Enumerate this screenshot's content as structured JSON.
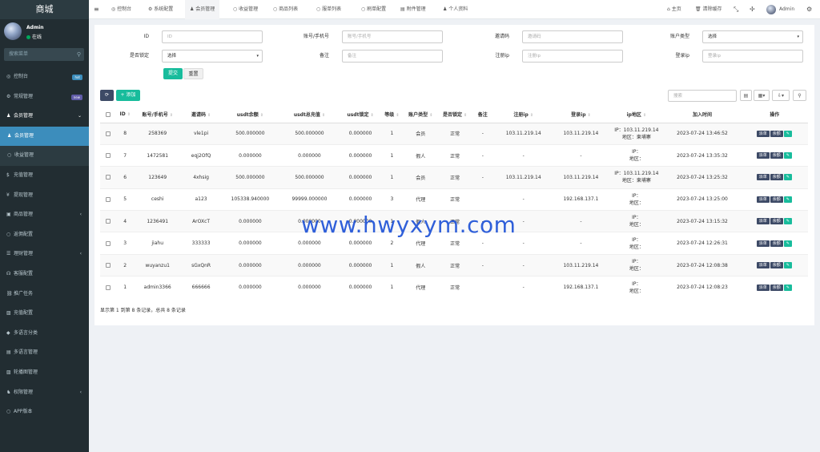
{
  "sidebar": {
    "logo": "商城",
    "user": {
      "name": "Admin",
      "status": "在线"
    },
    "search_placeholder": "搜索菜单",
    "items": [
      {
        "label": "控制台",
        "icon": "dashboard-icon",
        "badge": "hot",
        "badge_color": "#3c8dbc"
      },
      {
        "label": "常规管理",
        "icon": "cogs-icon",
        "badge": "new",
        "badge_color": "#605ca8"
      },
      {
        "label": "会员管理",
        "icon": "user-icon",
        "open": true
      },
      {
        "label": "会员管理",
        "icon": "user-icon",
        "sub": true,
        "active": true
      },
      {
        "label": "收益管理",
        "icon": "circle-icon",
        "sub": true
      },
      {
        "label": "充值管理",
        "icon": "dollar-icon"
      },
      {
        "label": "提现管理",
        "icon": "yen-icon"
      },
      {
        "label": "商品管理",
        "icon": "cart-icon",
        "chevron": true
      },
      {
        "label": "返佣配置",
        "icon": "circle-icon"
      },
      {
        "label": "理财管理",
        "icon": "list-icon",
        "chevron": true
      },
      {
        "label": "客服配置",
        "icon": "headset-icon"
      },
      {
        "label": "推广任务",
        "icon": "link-icon"
      },
      {
        "label": "充值配置",
        "icon": "image-icon"
      },
      {
        "label": "多语言分类",
        "icon": "tag-icon"
      },
      {
        "label": "多语言管理",
        "icon": "file-icon"
      },
      {
        "label": "轮播图管理",
        "icon": "image-icon"
      },
      {
        "label": "权限管理",
        "icon": "group-icon",
        "chevron": true
      },
      {
        "label": "APP版本",
        "icon": "circle-icon"
      }
    ]
  },
  "topbar": {
    "menu_icon": "≡",
    "tabs": [
      {
        "label": "控制台",
        "icon": "dashboard-icon"
      },
      {
        "label": "系统配置",
        "icon": "gear-icon"
      },
      {
        "label": "会员管理",
        "icon": "user-icon",
        "active": true
      },
      {
        "label": "收益管理",
        "icon": "circle-icon"
      },
      {
        "label": "商品列表",
        "icon": "circle-icon"
      },
      {
        "label": "服单列表",
        "icon": "circle-icon"
      },
      {
        "label": "刷单配置",
        "icon": "circle-icon"
      },
      {
        "label": "附件管理",
        "icon": "file-icon"
      },
      {
        "label": "个人资料",
        "icon": "user-icon"
      }
    ],
    "right": {
      "home": "主页",
      "clear_cache": "清除缓存",
      "user": "Admin"
    }
  },
  "filters": {
    "fields": [
      {
        "label": "ID",
        "placeholder": "ID"
      },
      {
        "label": "账号/手机号",
        "placeholder": "账号/手机号"
      },
      {
        "label": "邀请码",
        "placeholder": "邀请码"
      },
      {
        "label": "账户类型",
        "value": "选择",
        "select": true
      },
      {
        "label": "是否锁定",
        "value": "选择",
        "select": true
      },
      {
        "label": "备注",
        "placeholder": "备注"
      },
      {
        "label": "注册ip",
        "placeholder": "注册ip"
      },
      {
        "label": "登录ip",
        "placeholder": "登录ip"
      }
    ],
    "submit": "提交",
    "reset": "重置"
  },
  "toolbar": {
    "add": "添加",
    "search_placeholder": "搜索"
  },
  "table": {
    "columns": [
      "ID",
      "账号/手机号",
      "邀请码",
      "usdt余额",
      "usdt总充值",
      "usdt锁定",
      "等级",
      "账户类型",
      "是否锁定",
      "备注",
      "注册ip",
      "登录ip",
      "ip地区",
      "加入时间",
      "操作"
    ],
    "rows": [
      {
        "id": "8",
        "account": "258369",
        "invite": "vle1pi",
        "balance": "500.000000",
        "recharge": "500.000000",
        "locked": "0.000000",
        "level": "1",
        "type": "会员",
        "is_locked": "正常",
        "remark": "-",
        "reg_ip": "103.11.219.14",
        "login_ip": "103.11.219.14",
        "ip_line1": "IP：103.11.219.14",
        "ip_line2": "地区：柬埔寨",
        "time": "2023-07-24 13:46:52"
      },
      {
        "id": "7",
        "account": "1472581",
        "invite": "eqj2OfQ",
        "balance": "0.000000",
        "recharge": "0.000000",
        "locked": "0.000000",
        "level": "1",
        "type": "假人",
        "is_locked": "正常",
        "remark": "-",
        "reg_ip": "-",
        "login_ip": "-",
        "ip_line1": "IP：",
        "ip_line2": "地区：",
        "time": "2023-07-24 13:35:32"
      },
      {
        "id": "6",
        "account": "123649",
        "invite": "4xhsig",
        "balance": "500.000000",
        "recharge": "500.000000",
        "locked": "0.000000",
        "level": "1",
        "type": "会员",
        "is_locked": "正常",
        "remark": "-",
        "reg_ip": "103.11.219.14",
        "login_ip": "103.11.219.14",
        "ip_line1": "IP：103.11.219.14",
        "ip_line2": "地区：柬埔寨",
        "time": "2023-07-24 13:25:32"
      },
      {
        "id": "5",
        "account": "ceshi",
        "invite": "a123",
        "balance": "105338.940000",
        "recharge": "99999.000000",
        "locked": "0.000000",
        "level": "3",
        "type": "代理",
        "is_locked": "正常",
        "remark": "",
        "reg_ip": "-",
        "login_ip": "192.168.137.1",
        "ip_line1": "IP：",
        "ip_line2": "地区：",
        "time": "2023-07-24 13:25:00"
      },
      {
        "id": "4",
        "account": "1236491",
        "invite": "ArOXcT",
        "balance": "0.000000",
        "recharge": "0.000000",
        "locked": "0.000000",
        "level": "1",
        "type": "假人",
        "is_locked": "正常",
        "remark": "-",
        "reg_ip": "-",
        "login_ip": "-",
        "ip_line1": "IP：",
        "ip_line2": "地区：",
        "time": "2023-07-24 13:15:32"
      },
      {
        "id": "3",
        "account": "jiahu",
        "invite": "333333",
        "balance": "0.000000",
        "recharge": "0.000000",
        "locked": "0.000000",
        "level": "2",
        "type": "代理",
        "is_locked": "正常",
        "remark": "-",
        "reg_ip": "-",
        "login_ip": "-",
        "ip_line1": "IP：",
        "ip_line2": "地区：",
        "time": "2023-07-24 12:26:31"
      },
      {
        "id": "2",
        "account": "wuyanzu1",
        "invite": "sGxQnR",
        "balance": "0.000000",
        "recharge": "0.000000",
        "locked": "0.000000",
        "level": "1",
        "type": "假人",
        "is_locked": "正常",
        "remark": "-",
        "reg_ip": "-",
        "login_ip": "103.11.219.14",
        "ip_line1": "IP：",
        "ip_line2": "地区：",
        "time": "2023-07-24 12:08:38"
      },
      {
        "id": "1",
        "account": "admin3366",
        "invite": "666666",
        "balance": "0.000000",
        "recharge": "0.000000",
        "locked": "0.000000",
        "level": "1",
        "type": "代理",
        "is_locked": "正常",
        "remark": "",
        "reg_ip": "-",
        "login_ip": "192.168.137.1",
        "ip_line1": "IP：",
        "ip_line2": "地区：",
        "time": "2023-07-24 12:08:23"
      }
    ],
    "actions": [
      "派单",
      "余额"
    ]
  },
  "footer": "显示第 1 到第 8 条记录，总共 8 条记录",
  "watermark": "www.hwyxym.com",
  "colors": {
    "sidebar": "#222d32",
    "active": "#3c8dbc",
    "primary_button": "#18bc9c",
    "action": "#3d4a66"
  }
}
